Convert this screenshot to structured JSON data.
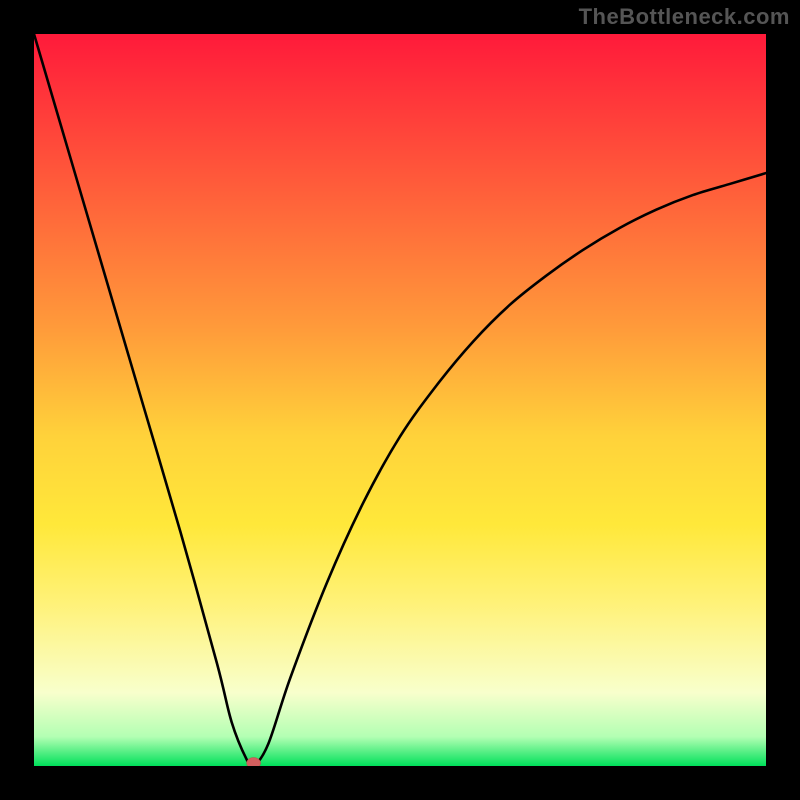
{
  "watermark": "TheBottleneck.com",
  "chart_data": {
    "type": "line",
    "title": "",
    "xlabel": "",
    "ylabel": "",
    "xlim": [
      0,
      100
    ],
    "ylim": [
      0,
      100
    ],
    "grid": false,
    "series": [
      {
        "name": "bottleneck-curve",
        "x": [
          0,
          5,
          10,
          15,
          20,
          25,
          27,
          29,
          30,
          32,
          35,
          40,
          45,
          50,
          55,
          60,
          65,
          70,
          75,
          80,
          85,
          90,
          95,
          100
        ],
        "values": [
          100,
          83,
          66,
          49,
          32,
          14,
          6,
          1,
          0,
          3,
          12,
          25,
          36,
          45,
          52,
          58,
          63,
          67,
          70.5,
          73.5,
          76,
          78,
          79.5,
          81
        ]
      }
    ],
    "marker": {
      "x": 30,
      "y": 0,
      "color": "#d35f5f",
      "radius": 6
    },
    "stroke": {
      "color": "#000000",
      "width": 2.6
    },
    "gradient_stops": [
      {
        "pct": 0,
        "color": "#ff1a3a"
      },
      {
        "pct": 10,
        "color": "#ff3a3a"
      },
      {
        "pct": 25,
        "color": "#ff6a3a"
      },
      {
        "pct": 40,
        "color": "#ff9a3a"
      },
      {
        "pct": 55,
        "color": "#ffd23a"
      },
      {
        "pct": 67,
        "color": "#ffe83a"
      },
      {
        "pct": 78,
        "color": "#fff27a"
      },
      {
        "pct": 90,
        "color": "#f8ffcc"
      },
      {
        "pct": 96,
        "color": "#b3ffb3"
      },
      {
        "pct": 100,
        "color": "#00e05a"
      }
    ]
  }
}
